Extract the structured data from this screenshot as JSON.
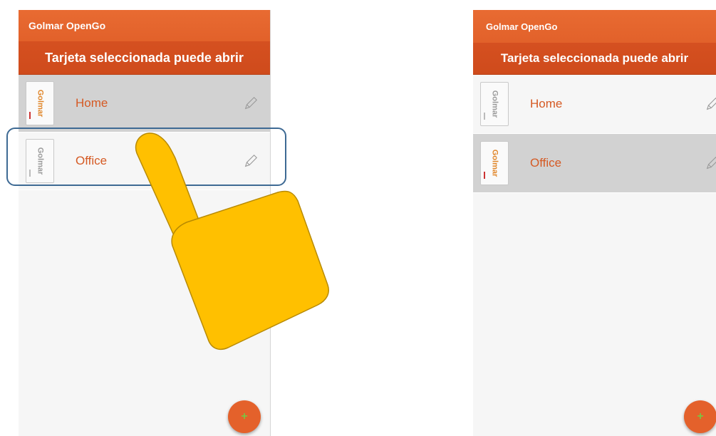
{
  "left_screen": {
    "app_title": "Golmar OpenGo",
    "subtitle": "Tarjeta seleccionada puede abrir",
    "cards": [
      {
        "label": "Home",
        "thumb_text": "Golmar",
        "selected": true
      },
      {
        "label": "Office",
        "thumb_text": "Golmar",
        "selected": false
      }
    ],
    "fab_label": "+"
  },
  "right_screen": {
    "app_title": "Golmar OpenGo",
    "subtitle": "Tarjeta seleccionada puede abrir",
    "cards": [
      {
        "label": "Home",
        "thumb_text": "Golmar",
        "selected": false
      },
      {
        "label": "Office",
        "thumb_text": "Golmar",
        "selected": true
      }
    ],
    "fab_label": "+"
  },
  "colors": {
    "accent": "#e2612a",
    "subbar": "#cf4b1c",
    "selected_row": "#d2d2d2",
    "label": "#d55a24",
    "highlight": "#3e6a94",
    "hand": "#ffc000"
  }
}
